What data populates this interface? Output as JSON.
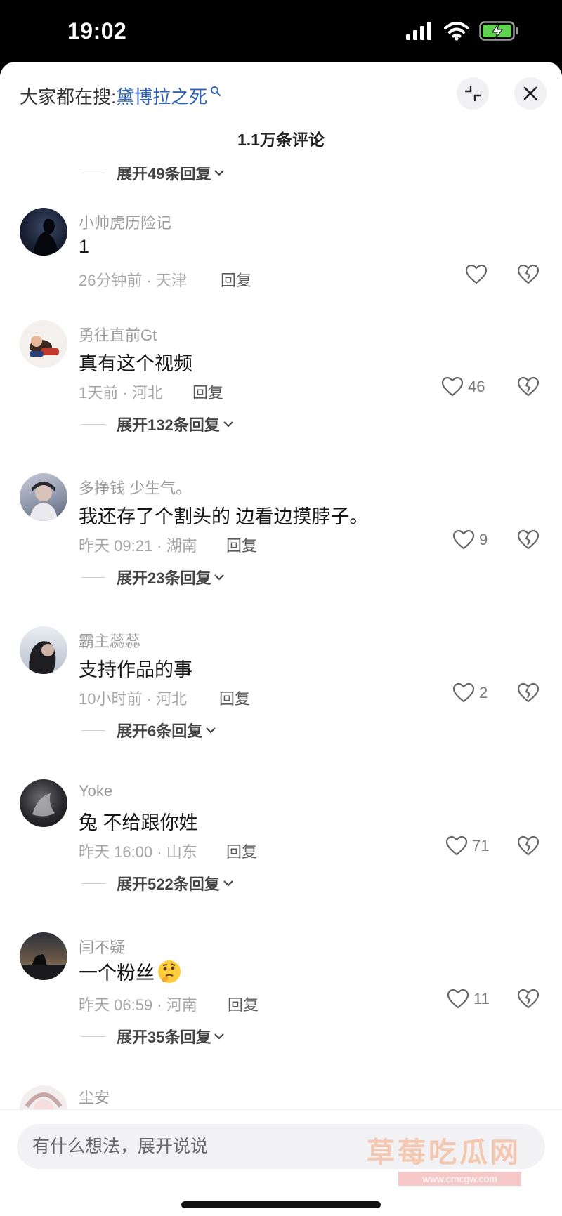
{
  "status_bar": {
    "time": "19:02"
  },
  "header": {
    "hot_search_label": "大家都在搜:",
    "hot_search_term": "黛博拉之死",
    "comment_count": "1.1万条评论"
  },
  "partial_expand": "展开49条回复",
  "reply_label": "回复",
  "comments": [
    {
      "username": "小帅虎历险记",
      "text": "1",
      "meta": "26分钟前 · 天津",
      "likes": "",
      "expand": ""
    },
    {
      "username": "勇往直前Gt",
      "text": "真有这个视频",
      "meta": "1天前 · 河北",
      "likes": "46",
      "expand": "展开132条回复"
    },
    {
      "username": "多挣钱 少生气。",
      "text": "我还存了个割头的 边看边摸脖子。",
      "meta": "昨天 09:21 · 湖南",
      "likes": "9",
      "expand": "展开23条回复"
    },
    {
      "username": "霸主蕊蕊",
      "text": "支持作品的事",
      "meta": "10小时前 · 河北",
      "likes": "2",
      "expand": "展开6条回复"
    },
    {
      "username": "Yoke",
      "text": "兔 不给跟你姓",
      "meta": "昨天 16:00 · 山东",
      "likes": "71",
      "expand": "展开522条回复"
    },
    {
      "username": "闫不疑",
      "text": "一个粉丝",
      "meta": "昨天 06:59 · 河南",
      "likes": "11",
      "expand": "展开35条回复"
    },
    {
      "username": "尘安",
      "text": "",
      "meta": "",
      "likes": "",
      "expand": ""
    }
  ],
  "input": {
    "placeholder": "有什么想法，展开说说"
  },
  "watermark": {
    "title": "草莓吃瓜网",
    "url": "www.cmcgw.com"
  }
}
